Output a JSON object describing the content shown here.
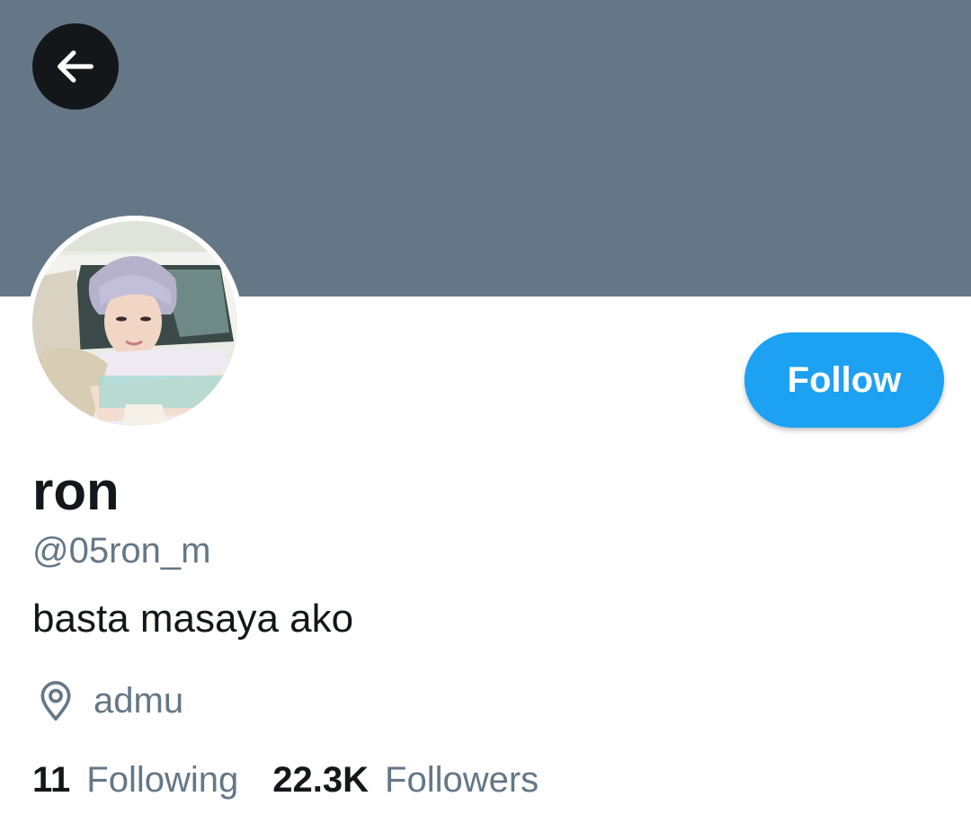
{
  "header": {
    "banner_color": "#657786",
    "back_icon": "arrow-left-icon"
  },
  "profile": {
    "display_name": "ron",
    "handle": "@05ron_m",
    "bio": "basta masaya ako",
    "location_icon": "location-pin-icon",
    "location": "admu",
    "follow_label": "Follow",
    "accent_color": "#1da1f2"
  },
  "stats": {
    "following_count": "11",
    "following_label": "Following",
    "followers_count": "22.3K",
    "followers_label": "Followers"
  }
}
